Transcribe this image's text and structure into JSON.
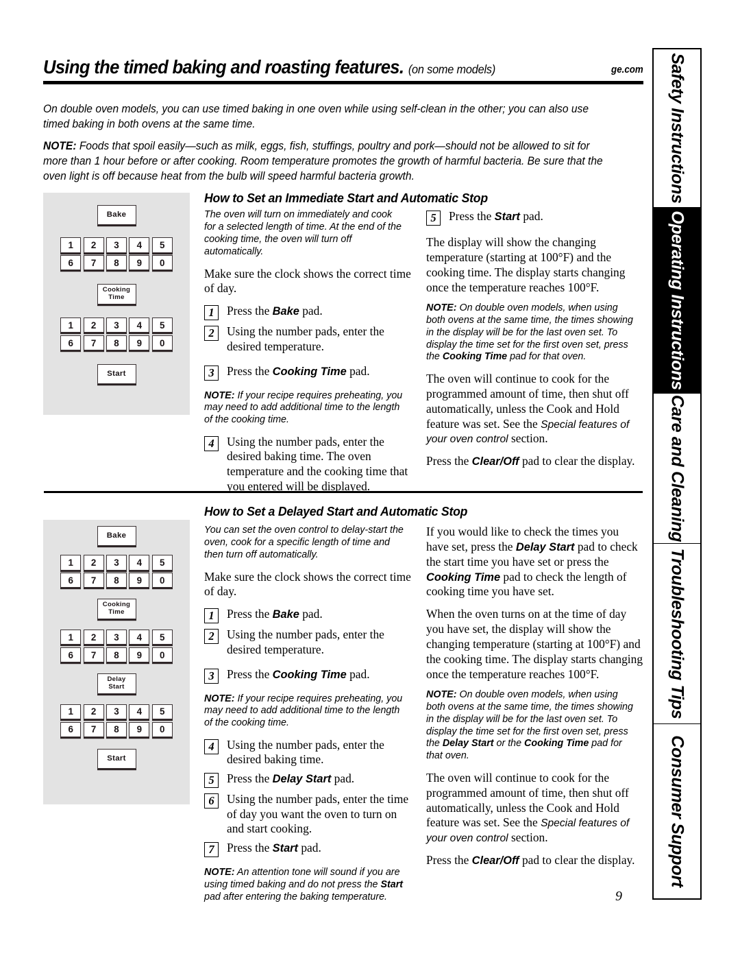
{
  "header": {
    "title": "Using the timed baking and roasting features.",
    "title_qualifier": "(on some models)",
    "brand_url": "ge.com"
  },
  "intro": {
    "paragraph1": "On double oven models, you can use timed baking in one oven while using self-clean in the other; you can also use timed baking in both ovens at the same time.",
    "note_label": "NOTE:",
    "note_text": " Foods that spoil easily—such as milk, eggs, fish, stuffings, poultry and pork—should not be allowed to sit for more than 1 hour before or after cooking. Room temperature promotes the growth of harmful bacteria. Be sure that the oven light is off because heat from the bulb will speed harmful bacteria growth."
  },
  "sections": {
    "immediate": {
      "heading": "How to Set an Immediate Start and Automatic Stop",
      "lead": "The oven will turn on immediately and cook for a selected length of time. At the end of the cooking time, the oven will turn off automatically.",
      "clock_note": "Make sure the clock shows the correct time of day.",
      "steps": [
        {
          "num": "1",
          "pre": "Press the ",
          "bold": "Bake",
          "post": " pad."
        },
        {
          "num": "2",
          "pre": "Using the number pads, enter the desired temperature.",
          "bold": "",
          "post": ""
        },
        {
          "num": "3",
          "pre": "Press the ",
          "bold": "Cooking Time",
          "post": " pad."
        },
        {
          "num": "4",
          "pre": "Using the number pads, enter the desired baking time. The oven temperature and the cooking time that you entered will be displayed.",
          "bold": "",
          "post": ""
        },
        {
          "num": "5",
          "pre": "Press the ",
          "bold": "Start",
          "post": " pad."
        }
      ],
      "preheat_note_label": "NOTE:",
      "preheat_note_text": " If your recipe requires preheating, you may need to add additional time to the length of the cooking time.",
      "display_paragraph": "The display will show the changing temperature (starting at 100°F) and the cooking time. The display starts changing once the temperature reaches 100°F.",
      "double_oven_note_label": "NOTE:",
      "double_oven_note_a": " On double oven models, when using both ovens at the same time, the times showing in the display will be for the last oven set. To display the time set for the first oven set, press the ",
      "double_oven_note_bold": "Cooking Time",
      "double_oven_note_b": " pad for that oven.",
      "continue_paragraph_a": "The oven will continue to cook for the programmed amount of time, then shut off automatically, unless the Cook and Hold feature was set. See the ",
      "continue_paragraph_italic": "Special features of your oven control",
      "continue_paragraph_b": " section.",
      "clear_a": "Press the ",
      "clear_bold": "Clear/Off",
      "clear_b": " pad to clear the display."
    },
    "delayed": {
      "heading": "How to Set a Delayed Start and Automatic Stop",
      "lead": "You can set the oven control to delay-start the oven, cook for a specific length of time and then turn off automatically.",
      "clock_note": "Make sure the clock shows the correct time of day.",
      "steps": [
        {
          "num": "1",
          "pre": "Press the ",
          "bold": "Bake",
          "post": " pad."
        },
        {
          "num": "2",
          "pre": "Using the number pads, enter the desired temperature.",
          "bold": "",
          "post": ""
        },
        {
          "num": "3",
          "pre": "Press the ",
          "bold": "Cooking Time",
          "post": " pad."
        },
        {
          "num": "4",
          "pre": "Using the number pads, enter the desired baking time.",
          "bold": "",
          "post": ""
        },
        {
          "num": "5",
          "pre": "Press the ",
          "bold": "Delay Start",
          "post": " pad."
        },
        {
          "num": "6",
          "pre": "Using the number pads, enter the time of day you want the oven to turn on and start cooking.",
          "bold": "",
          "post": ""
        },
        {
          "num": "7",
          "pre": "Press the ",
          "bold": "Start",
          "post": " pad."
        }
      ],
      "preheat_note_label": "NOTE:",
      "preheat_note_text": " If your recipe requires preheating, you may need to add additional time to the length of the cooking time.",
      "attention_note_label": "NOTE:",
      "attention_note_a": " An attention tone will sound if you are using timed baking and do not press the ",
      "attention_note_bold": "Start",
      "attention_note_b": " pad after entering the baking temperature.",
      "check_times_a": "If you would like to check the times you have set, press the ",
      "check_times_bold1": "Delay Start",
      "check_times_b": " pad to check the start time you have set or press the ",
      "check_times_bold2": "Cooking Time",
      "check_times_c": " pad to check the length of cooking time you have set.",
      "turns_on_paragraph": "When the oven turns on at the time of day you have set, the display will show the changing temperature (starting at 100°F) and the cooking time. The display starts changing once the temperature reaches 100°F.",
      "double_oven_note_label": "NOTE:",
      "double_oven_note_a": " On double oven models, when using both ovens at the same time, the times showing in the display will be for the last oven set. To display the time set for the first oven set, press the ",
      "double_oven_note_bold1": "Delay Start",
      "double_oven_note_mid": " or the ",
      "double_oven_note_bold2": "Cooking Time",
      "double_oven_note_b": " pad for that oven.",
      "continue_paragraph_a": "The oven will continue to cook for the programmed amount of time, then shut off automatically, unless the Cook and Hold feature was set. See the ",
      "continue_paragraph_italic": "Special features of your oven control",
      "continue_paragraph_b": " section.",
      "clear_a": "Press the ",
      "clear_bold": "Clear/Off",
      "clear_b": " pad to clear the display."
    }
  },
  "control_panels": {
    "immediate": {
      "keys": [
        "Bake",
        "Cooking Time",
        "Start"
      ],
      "bake_label": "Bake",
      "cooking_time_label_1": "Cooking",
      "cooking_time_label_2": "Time",
      "start_label": "Start",
      "number_row_top": [
        "1",
        "2",
        "3",
        "4",
        "5"
      ],
      "number_row_bottom": [
        "6",
        "7",
        "8",
        "9",
        "0"
      ]
    },
    "delayed": {
      "bake_label": "Bake",
      "cooking_time_label_1": "Cooking",
      "cooking_time_label_2": "Time",
      "delay_start_label_1": "Delay",
      "delay_start_label_2": "Start",
      "start_label": "Start",
      "number_row_top": [
        "1",
        "2",
        "3",
        "4",
        "5"
      ],
      "number_row_bottom": [
        "6",
        "7",
        "8",
        "9",
        "0"
      ]
    }
  },
  "side_tabs": [
    {
      "label": "Safety Instructions",
      "active": false
    },
    {
      "label": "Operating Instructions",
      "active": true
    },
    {
      "label": "Care and Cleaning",
      "active": false
    },
    {
      "label": "Troubleshooting Tips",
      "active": false
    },
    {
      "label": "Consumer Support",
      "active": false
    }
  ],
  "page_number": "9"
}
